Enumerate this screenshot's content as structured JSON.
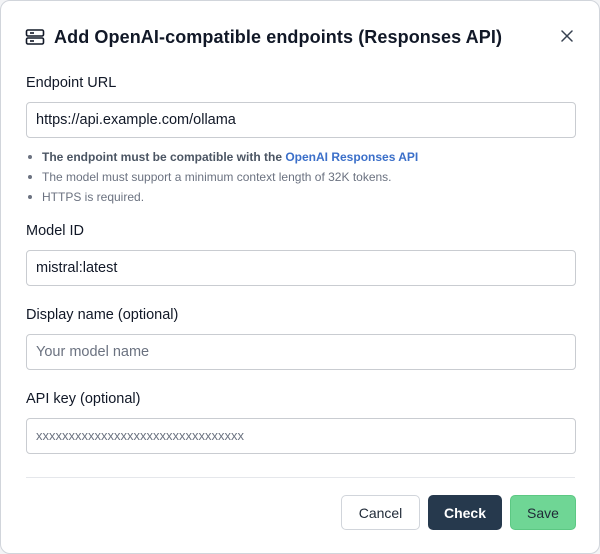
{
  "dialog": {
    "title": "Add OpenAI-compatible endpoints (Responses API)",
    "header_icon": "server-stack-icon",
    "close_icon": "close-icon"
  },
  "endpoint": {
    "label": "Endpoint URL",
    "value": "https://api.example.com/ollama",
    "hints": {
      "compat_prefix": "The endpoint must be compatible with the ",
      "compat_link": "OpenAI Responses API",
      "context": "The model must support a minimum context length of 32K tokens.",
      "https": "HTTPS is required."
    }
  },
  "model_id": {
    "label": "Model ID",
    "value": "mistral:latest"
  },
  "display_name": {
    "label": "Display name (optional)",
    "placeholder": "Your model name"
  },
  "api_key": {
    "label": "API key (optional)",
    "placeholder": "xxxxxxxxxxxxxxxxxxxxxxxxxxxxxxxx"
  },
  "footer": {
    "cancel_label": "Cancel",
    "check_label": "Check",
    "save_label": "Save"
  },
  "colors": {
    "check_bg": "#26394d",
    "save_bg": "#6fd695",
    "link": "#3b6fc9"
  }
}
